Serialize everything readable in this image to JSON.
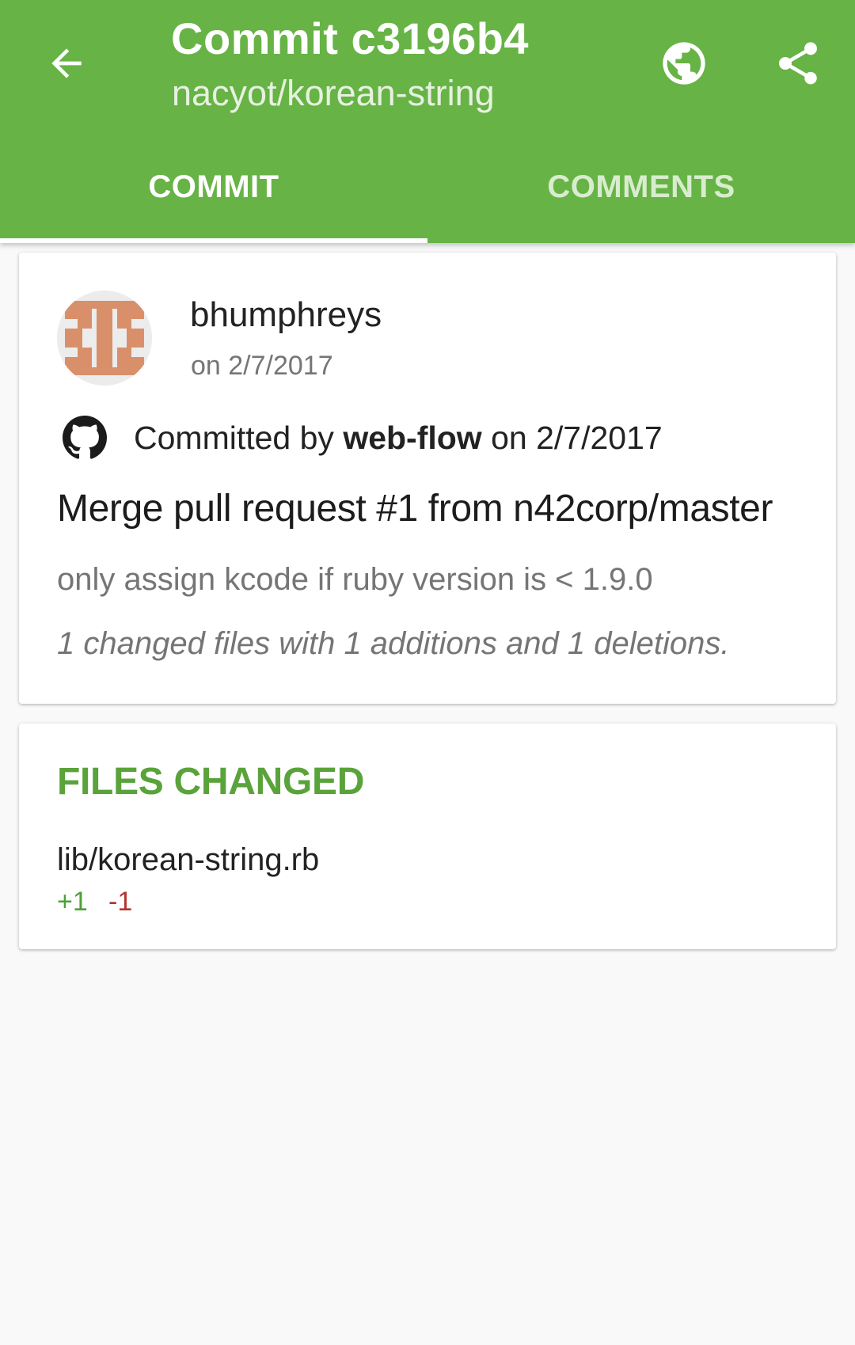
{
  "appbar": {
    "title": "Commit c3196b4",
    "subtitle": "nacyot/korean-string",
    "back_icon": "arrow-back-icon",
    "browser_icon": "globe-icon",
    "share_icon": "share-icon"
  },
  "tabs": [
    {
      "label": "COMMIT",
      "active": true
    },
    {
      "label": "COMMENTS",
      "active": false
    }
  ],
  "commit": {
    "author": "bhumphreys",
    "author_date": "on 2/7/2017",
    "committed_by_prefix": "Committed by ",
    "committer": "web-flow",
    "committed_on": " on 2/7/2017",
    "message": "Merge pull request #1 from n42corp/master",
    "description": "only assign kcode if ruby version is < 1.9.0",
    "stats": "1 changed files with 1 additions and 1 deletions."
  },
  "files_changed": {
    "header": "FILES CHANGED",
    "files": [
      {
        "name": "lib/korean-string.rb",
        "additions": "+1",
        "deletions": "-1"
      }
    ]
  },
  "colors": {
    "primary": "#67b346",
    "accent_text": "#5aa33a",
    "addition": "#4ea03a",
    "deletion": "#b3342f",
    "avatar_identicon": "#d9906a"
  }
}
